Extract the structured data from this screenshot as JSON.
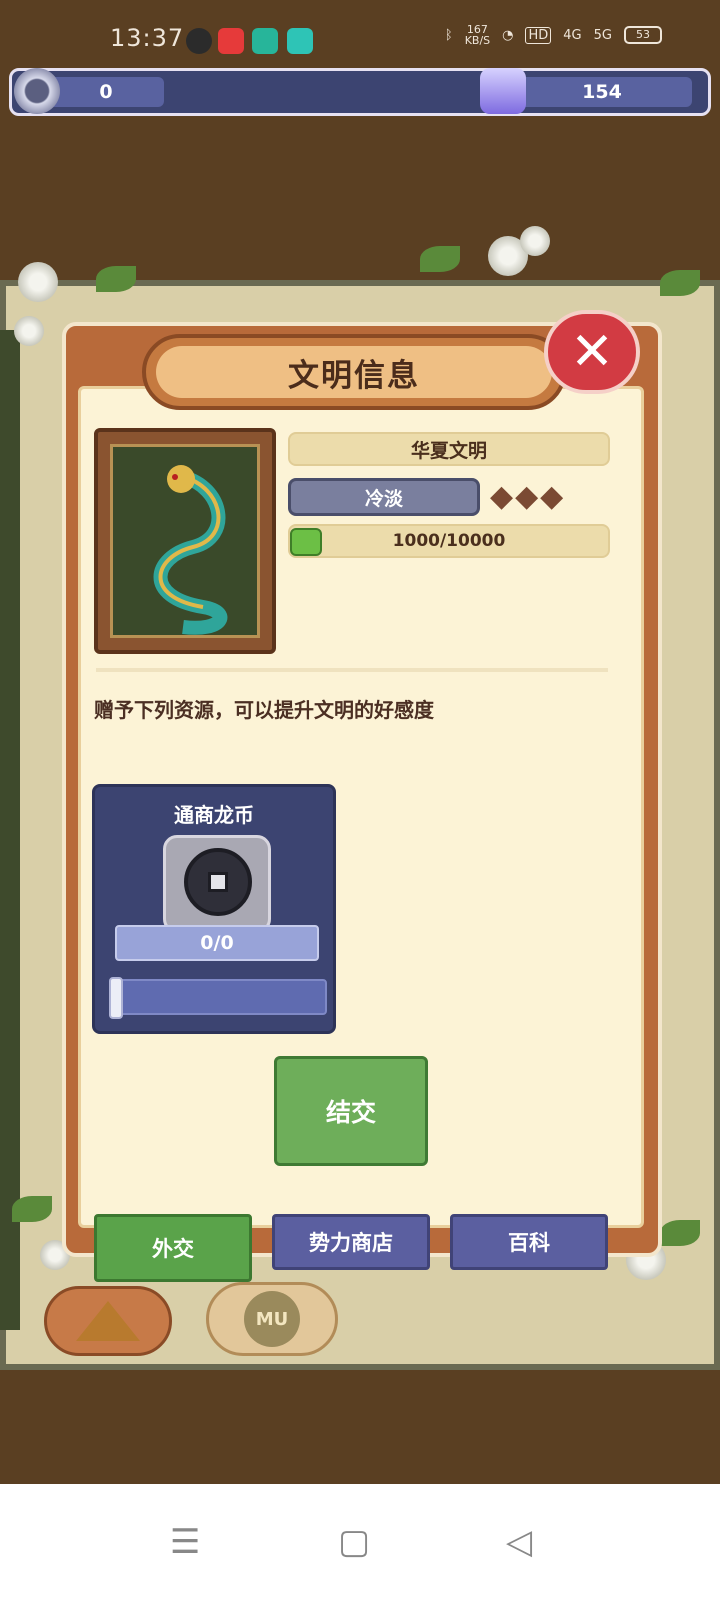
{
  "status_bar": {
    "time": "13:37",
    "speed_value": "167",
    "speed_unit": "KB/S",
    "battery": "53",
    "signal_4g": "4G",
    "signal_5g": "5G",
    "hd_label": "HD"
  },
  "resources": {
    "left_value": "0",
    "right_value": "154"
  },
  "modal": {
    "title": "文明信息",
    "civilization_name": "华夏文明",
    "attitude": "冷淡",
    "hearts_total": 3,
    "hearts_filled": 0,
    "progress": "1000/10000",
    "description": "赠予下列资源，可以提升文明的好感度",
    "gift_card": {
      "title": "通商龙币",
      "count": "0/0"
    },
    "befriend_label": "结交"
  },
  "tabs": [
    {
      "label": "外交"
    },
    {
      "label": "势力商店"
    },
    {
      "label": "百科"
    }
  ],
  "icons": {
    "close": "close-icon",
    "coin": "coin-icon",
    "heart": "heart-icon",
    "pyramid": "pyramid-icon",
    "potion": "potion-icon"
  },
  "colors": {
    "accent_red": "#d23b43",
    "accent_green": "#6eae5a",
    "panel_blue": "#3c4471",
    "parchment": "#fcf3d6"
  }
}
